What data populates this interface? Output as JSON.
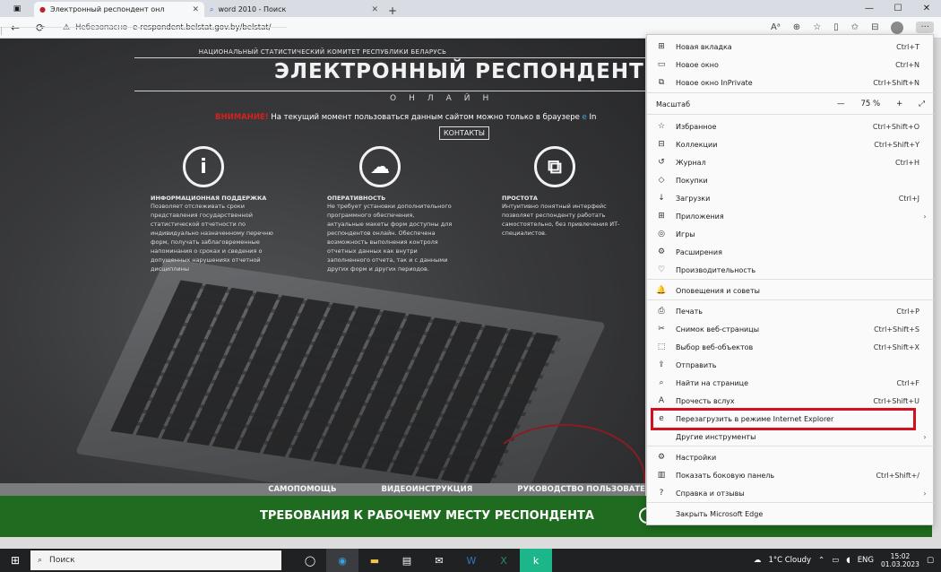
{
  "browser": {
    "tabs": [
      {
        "title": "Электронный респондент онл",
        "active": true
      },
      {
        "title": "word 2010 - Поиск",
        "active": false
      }
    ],
    "address": {
      "security": "Небезопасно",
      "url": "e-respondent.belstat.gov.by/belstat/"
    },
    "window_controls": {
      "minimize": "—",
      "maximize": "☐",
      "close": "✕"
    }
  },
  "page": {
    "ministry": "НАЦИОНАЛЬНЫЙ СТАТИСТИЧЕСКИЙ КОМИТЕТ РЕСПУБЛИКИ БЕЛАРУСЬ",
    "title": "ЭЛЕКТРОННЫЙ РЕСПОНДЕНТ",
    "subtitle": "ОНЛАЙН",
    "notice_label": "ВНИМАНИЕ!",
    "notice_text": "На текущий момент пользоваться данным сайтом можно только в браузере",
    "notice_tail": "In",
    "contacts": "КОНТАКТЫ",
    "features": [
      {
        "icon": "i",
        "heading": "ИНФОРМАЦИОННАЯ ПОДДЕРЖКА",
        "text": "Позволяет отслеживать сроки представления государственной статистической отчетности по индивидуально назначенному перечню форм, получать заблаговременные напоминания о сроках и сведения о допущенных нарушениях отчетной дисциплины"
      },
      {
        "icon": "☁",
        "heading": "ОПЕРАТИВНОСТЬ",
        "text": "Не требует установки дополнительного программного обеспечения, актуальные макеты форм доступны для респондентов онлайн. Обеспечена возможность выполнения контроля отчетных данных как внутри заполненного отчета, так и с данными других форм и других периодов."
      },
      {
        "icon": "⧉",
        "heading": "ПРОСТОТА",
        "text": "Интуитивно понятный интерфейс позволяет респонденту работать самостоятельно, без привлечения ИТ-специалистов."
      }
    ],
    "bottom_links": [
      "САМОПОМОЩЬ",
      "ВИДЕОИНСТРУКЦИЯ",
      "РУКОВОДСТВО ПОЛЬЗОВАТЕ"
    ],
    "green_band_text": "ТРЕБОВАНИЯ К РАБОЧЕМУ МЕСТУ РЕСПОНДЕНТА"
  },
  "menu": {
    "items": [
      {
        "label": "Новая вкладка",
        "shortcut": "Ctrl+T",
        "icon": "⊞"
      },
      {
        "label": "Новое окно",
        "shortcut": "Ctrl+N",
        "icon": "▭"
      },
      {
        "label": "Новое окно InPrivate",
        "shortcut": "Ctrl+Shift+N",
        "icon": "⧉"
      },
      {
        "label": "Масштаб",
        "zoom_minus": "—",
        "zoom_value": "75 %",
        "zoom_plus": "+",
        "zoom_full": "⤢"
      },
      {
        "label": "Избранное",
        "shortcut": "Ctrl+Shift+O",
        "icon": "☆"
      },
      {
        "label": "Коллекции",
        "shortcut": "Ctrl+Shift+Y",
        "icon": "⊟"
      },
      {
        "label": "Журнал",
        "shortcut": "Ctrl+H",
        "icon": "↺"
      },
      {
        "label": "Покупки",
        "shortcut": "",
        "icon": "◇"
      },
      {
        "label": "Загрузки",
        "shortcut": "Ctrl+J",
        "icon": "↓"
      },
      {
        "label": "Приложения",
        "shortcut": "",
        "icon": "⊞",
        "arrow": "›"
      },
      {
        "label": "Игры",
        "shortcut": "",
        "icon": "◎"
      },
      {
        "label": "Расширения",
        "shortcut": "",
        "icon": "⚙"
      },
      {
        "label": "Производительность",
        "shortcut": "",
        "icon": "♡"
      },
      {
        "label": "Оповещения и советы",
        "shortcut": "",
        "icon": "🔔"
      },
      {
        "label": "Печать",
        "shortcut": "Ctrl+P",
        "icon": "⎙"
      },
      {
        "label": "Снимок веб-страницы",
        "shortcut": "Ctrl+Shift+S",
        "icon": "✂"
      },
      {
        "label": "Выбор веб-объектов",
        "shortcut": "Ctrl+Shift+X",
        "icon": "⬚"
      },
      {
        "label": "Отправить",
        "shortcut": "",
        "icon": "⇪"
      },
      {
        "label": "Найти на странице",
        "shortcut": "Ctrl+F",
        "icon": "⌕"
      },
      {
        "label": "Прочесть вслух",
        "shortcut": "Ctrl+Shift+U",
        "icon": "A"
      },
      {
        "label": "Перезагрузить в режиме Internet Explorer",
        "shortcut": "",
        "icon": "e"
      },
      {
        "label": "Другие инструменты",
        "shortcut": "",
        "icon": "",
        "arrow": "›"
      },
      {
        "label": "Настройки",
        "shortcut": "",
        "icon": "⚙"
      },
      {
        "label": "Показать боковую панель",
        "shortcut": "Ctrl+Shift+/",
        "icon": "▥"
      },
      {
        "label": "Справка и отзывы",
        "shortcut": "",
        "icon": "?",
        "arrow": "›"
      },
      {
        "label": "Закрыть Microsoft Edge",
        "shortcut": "",
        "icon": ""
      }
    ]
  },
  "taskbar": {
    "search_placeholder": "Поиск",
    "weather": "1°C  Cloudy",
    "lang": "ENG",
    "time": "15:02",
    "date": "01.03.2023"
  }
}
